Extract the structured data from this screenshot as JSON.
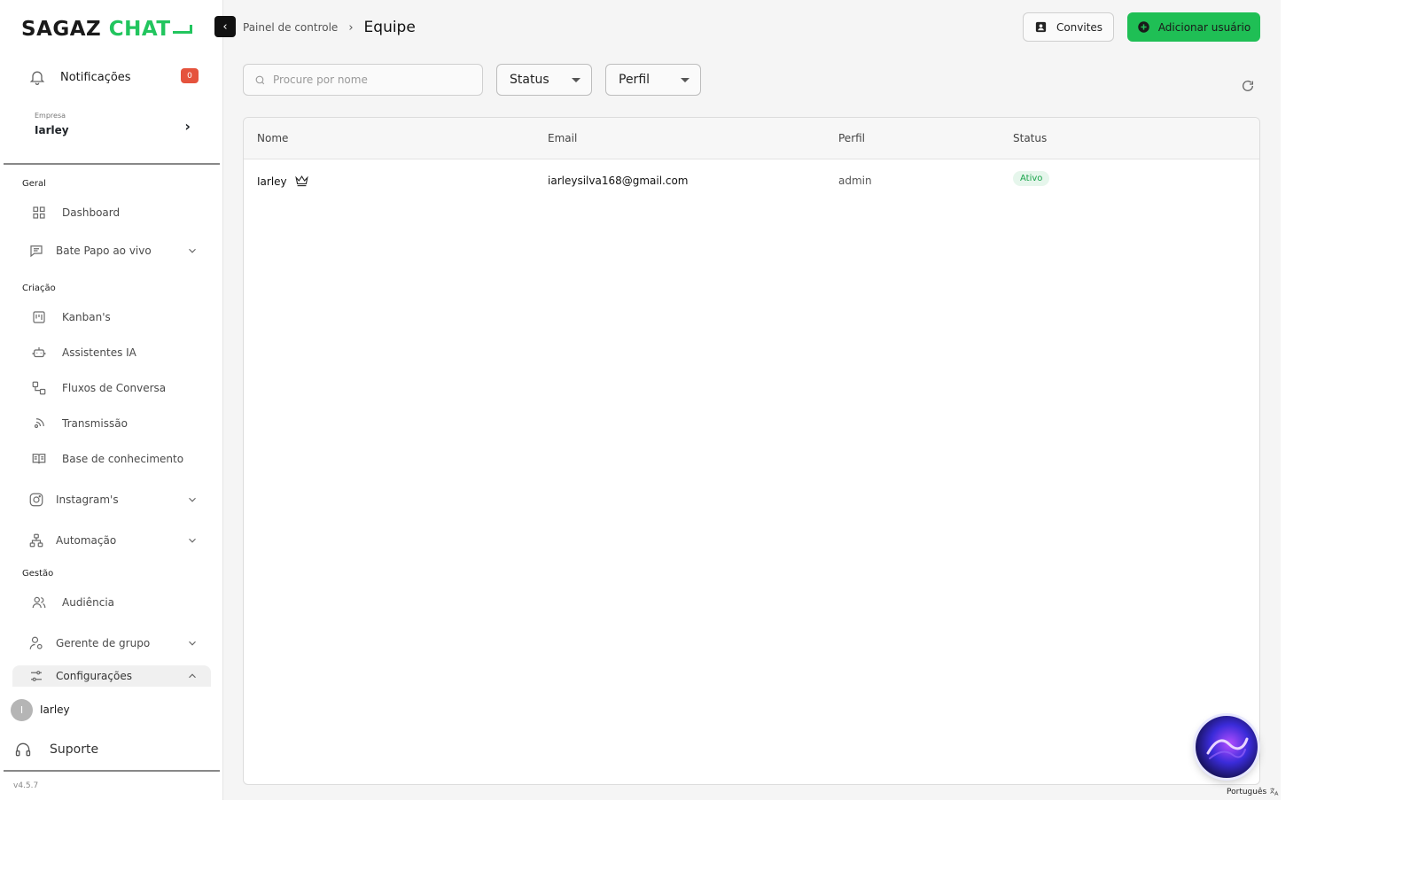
{
  "logo": {
    "part1": "SAGAZ",
    "part2": "CHAT"
  },
  "notifications": {
    "label": "Notificações",
    "count": "0"
  },
  "company": {
    "caption": "Empresa",
    "name": "Iarley"
  },
  "sidebar": {
    "sections": {
      "general": "Geral",
      "creation": "Criação",
      "management": "Gestão"
    },
    "items": [
      {
        "label": "Dashboard",
        "icon": "dashboard-icon"
      },
      {
        "label": "Bate Papo ao vivo",
        "icon": "chat-icon"
      },
      {
        "label": "Kanban's",
        "icon": "kanban-icon"
      },
      {
        "label": "Assistentes IA",
        "icon": "robot-icon"
      },
      {
        "label": "Fluxos de Conversa",
        "icon": "flow-icon"
      },
      {
        "label": "Transmissão",
        "icon": "broadcast-icon"
      },
      {
        "label": "Base de conhecimento",
        "icon": "book-icon"
      },
      {
        "label": "Instagram's",
        "icon": "instagram-icon"
      },
      {
        "label": "Automação",
        "icon": "automation-icon"
      },
      {
        "label": "Audiência",
        "icon": "audience-icon"
      },
      {
        "label": "Gerente de grupo",
        "icon": "group-manager-icon"
      },
      {
        "label": "Configurações",
        "icon": "settings-icon"
      }
    ]
  },
  "user": {
    "initial": "I",
    "name": "Iarley"
  },
  "support": {
    "label": "Suporte"
  },
  "version": "v4.5.7",
  "breadcrumb": {
    "parent": "Painel de controle",
    "current": "Equipe"
  },
  "actions": {
    "invites": "Convites",
    "add_user": "Adicionar usuário"
  },
  "filters": {
    "search_placeholder": "Procure por nome",
    "status": "Status",
    "profile": "Perfil"
  },
  "table": {
    "headers": {
      "name": "Nome",
      "email": "Email",
      "profile": "Perfil",
      "status": "Status"
    },
    "rows": [
      {
        "name": "Iarley",
        "email": "iarleysilva168@gmail.com",
        "profile": "admin",
        "status": "Ativo"
      }
    ]
  },
  "language": "Português",
  "colors": {
    "brand_green": "#1fbf55",
    "badge_red": "#e5533d",
    "active_status": "#19a34a"
  }
}
